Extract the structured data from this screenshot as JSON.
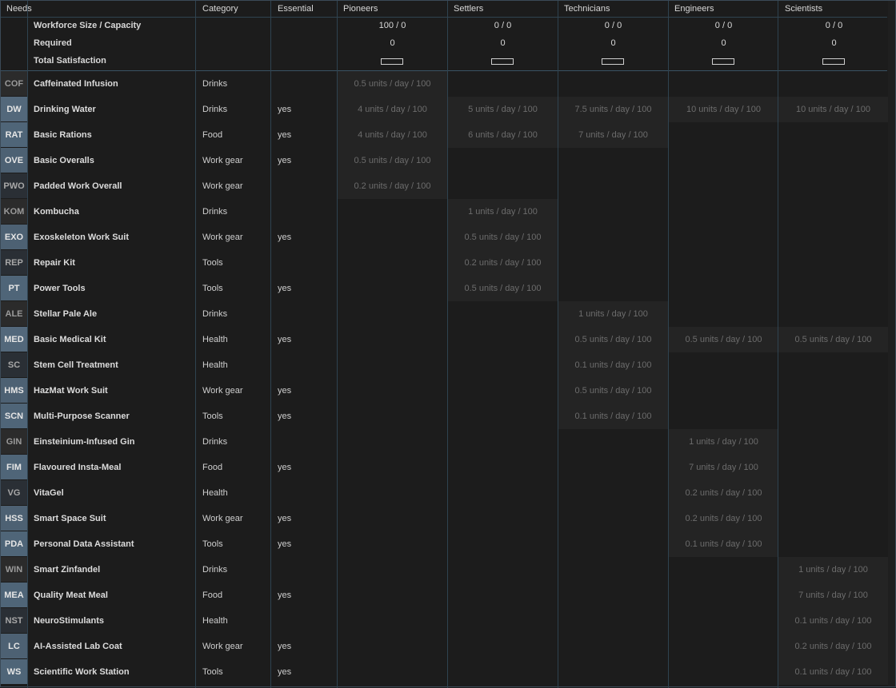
{
  "headers": {
    "needs": "Needs",
    "category": "Category",
    "essential": "Essential",
    "tiers": [
      "Pioneers",
      "Settlers",
      "Technicians",
      "Engineers",
      "Scientists"
    ]
  },
  "summary": {
    "workforce_label": "Workforce Size / Capacity",
    "required_label": "Required",
    "satisfaction_label": "Total Satisfaction",
    "workforce": [
      "100 / 0",
      "0 / 0",
      "0 / 0",
      "0 / 0",
      "0 / 0"
    ],
    "required": [
      "0",
      "0",
      "0",
      "0",
      "0"
    ]
  },
  "rows": [
    {
      "ticker": "COF",
      "name": "Caffeinated Infusion",
      "category": "Drinks",
      "essential": "",
      "color": "#2b2b2b",
      "tcolor": "#9a9a9a",
      "cells": [
        "0.5 units / day / 100",
        "",
        "",
        "",
        ""
      ]
    },
    {
      "ticker": "DW",
      "name": "Drinking Water",
      "category": "Drinks",
      "essential": "yes",
      "color": "#53687b",
      "tcolor": "#e6e6e6",
      "cells": [
        "4 units / day / 100",
        "5 units / day / 100",
        "7.5 units / day / 100",
        "10 units / day / 100",
        "10 units / day / 100"
      ]
    },
    {
      "ticker": "RAT",
      "name": "Basic Rations",
      "category": "Food",
      "essential": "yes",
      "color": "#4f6578",
      "tcolor": "#e6e6e6",
      "cells": [
        "4 units / day / 100",
        "6 units / day / 100",
        "7 units / day / 100",
        "",
        ""
      ]
    },
    {
      "ticker": "OVE",
      "name": "Basic Overalls",
      "category": "Work gear",
      "essential": "yes",
      "color": "#4d6173",
      "tcolor": "#e6e6e6",
      "cells": [
        "0.5 units / day / 100",
        "",
        "",
        "",
        ""
      ]
    },
    {
      "ticker": "PWO",
      "name": "Padded Work Overall",
      "category": "Work gear",
      "essential": "",
      "color": "#2a2f35",
      "tcolor": "#a8a8a8",
      "cells": [
        "0.2 units / day / 100",
        "",
        "",
        "",
        ""
      ]
    },
    {
      "ticker": "KOM",
      "name": "Kombucha",
      "category": "Drinks",
      "essential": "",
      "color": "#2b2b2b",
      "tcolor": "#9a9a9a",
      "cells": [
        "",
        "1 units / day / 100",
        "",
        "",
        ""
      ]
    },
    {
      "ticker": "EXO",
      "name": "Exoskeleton Work Suit",
      "category": "Work gear",
      "essential": "yes",
      "color": "#4d6173",
      "tcolor": "#e6e6e6",
      "cells": [
        "",
        "0.5 units / day / 100",
        "",
        "",
        ""
      ]
    },
    {
      "ticker": "REP",
      "name": "Repair Kit",
      "category": "Tools",
      "essential": "",
      "color": "#2a2f35",
      "tcolor": "#a8a8a8",
      "cells": [
        "",
        "0.2 units / day / 100",
        "",
        "",
        ""
      ]
    },
    {
      "ticker": "PT",
      "name": "Power Tools",
      "category": "Tools",
      "essential": "yes",
      "color": "#4f6578",
      "tcolor": "#e6e6e6",
      "cells": [
        "",
        "0.5 units / day / 100",
        "",
        "",
        ""
      ]
    },
    {
      "ticker": "ALE",
      "name": "Stellar Pale Ale",
      "category": "Drinks",
      "essential": "",
      "color": "#2b2b2b",
      "tcolor": "#9a9a9a",
      "cells": [
        "",
        "",
        "1 units / day / 100",
        "",
        ""
      ]
    },
    {
      "ticker": "MED",
      "name": "Basic Medical Kit",
      "category": "Health",
      "essential": "yes",
      "color": "#53687b",
      "tcolor": "#e6e6e6",
      "cells": [
        "",
        "",
        "0.5 units / day / 100",
        "0.5 units / day / 100",
        "0.5 units / day / 100"
      ]
    },
    {
      "ticker": "SC",
      "name": "Stem Cell Treatment",
      "category": "Health",
      "essential": "",
      "color": "#2a2f35",
      "tcolor": "#a8a8a8",
      "cells": [
        "",
        "",
        "0.1 units / day / 100",
        "",
        ""
      ]
    },
    {
      "ticker": "HMS",
      "name": "HazMat Work Suit",
      "category": "Work gear",
      "essential": "yes",
      "color": "#4d6173",
      "tcolor": "#e6e6e6",
      "cells": [
        "",
        "",
        "0.5 units / day / 100",
        "",
        ""
      ]
    },
    {
      "ticker": "SCN",
      "name": "Multi-Purpose Scanner",
      "category": "Tools",
      "essential": "yes",
      "color": "#4f6578",
      "tcolor": "#e6e6e6",
      "cells": [
        "",
        "",
        "0.1 units / day / 100",
        "",
        ""
      ]
    },
    {
      "ticker": "GIN",
      "name": "Einsteinium-Infused Gin",
      "category": "Drinks",
      "essential": "",
      "color": "#2b2b2b",
      "tcolor": "#9a9a9a",
      "cells": [
        "",
        "",
        "",
        "1 units / day / 100",
        ""
      ]
    },
    {
      "ticker": "FIM",
      "name": "Flavoured Insta-Meal",
      "category": "Food",
      "essential": "yes",
      "color": "#4f6578",
      "tcolor": "#e6e6e6",
      "cells": [
        "",
        "",
        "",
        "7 units / day / 100",
        ""
      ]
    },
    {
      "ticker": "VG",
      "name": "VitaGel",
      "category": "Health",
      "essential": "",
      "color": "#2a2f35",
      "tcolor": "#a8a8a8",
      "cells": [
        "",
        "",
        "",
        "0.2 units / day / 100",
        ""
      ]
    },
    {
      "ticker": "HSS",
      "name": "Smart Space Suit",
      "category": "Work gear",
      "essential": "yes",
      "color": "#4d6173",
      "tcolor": "#e6e6e6",
      "cells": [
        "",
        "",
        "",
        "0.2 units / day / 100",
        ""
      ]
    },
    {
      "ticker": "PDA",
      "name": "Personal Data Assistant",
      "category": "Tools",
      "essential": "yes",
      "color": "#4f6578",
      "tcolor": "#e6e6e6",
      "cells": [
        "",
        "",
        "",
        "0.1 units / day / 100",
        ""
      ]
    },
    {
      "ticker": "WIN",
      "name": "Smart Zinfandel",
      "category": "Drinks",
      "essential": "",
      "color": "#2b2b2b",
      "tcolor": "#9a9a9a",
      "cells": [
        "",
        "",
        "",
        "",
        "1 units / day / 100"
      ]
    },
    {
      "ticker": "MEA",
      "name": "Quality Meat Meal",
      "category": "Food",
      "essential": "yes",
      "color": "#4f6578",
      "tcolor": "#e6e6e6",
      "cells": [
        "",
        "",
        "",
        "",
        "7 units / day / 100"
      ]
    },
    {
      "ticker": "NST",
      "name": "NeuroStimulants",
      "category": "Health",
      "essential": "",
      "color": "#2a2f35",
      "tcolor": "#a8a8a8",
      "cells": [
        "",
        "",
        "",
        "",
        "0.1 units / day / 100"
      ]
    },
    {
      "ticker": "LC",
      "name": "AI-Assisted Lab Coat",
      "category": "Work gear",
      "essential": "yes",
      "color": "#4d6173",
      "tcolor": "#e6e6e6",
      "cells": [
        "",
        "",
        "",
        "",
        "0.2 units / day / 100"
      ]
    },
    {
      "ticker": "WS",
      "name": "Scientific Work Station",
      "category": "Tools",
      "essential": "yes",
      "color": "#4f6578",
      "tcolor": "#e6e6e6",
      "cells": [
        "",
        "",
        "",
        "",
        "0.1 units / day / 100"
      ]
    }
  ]
}
